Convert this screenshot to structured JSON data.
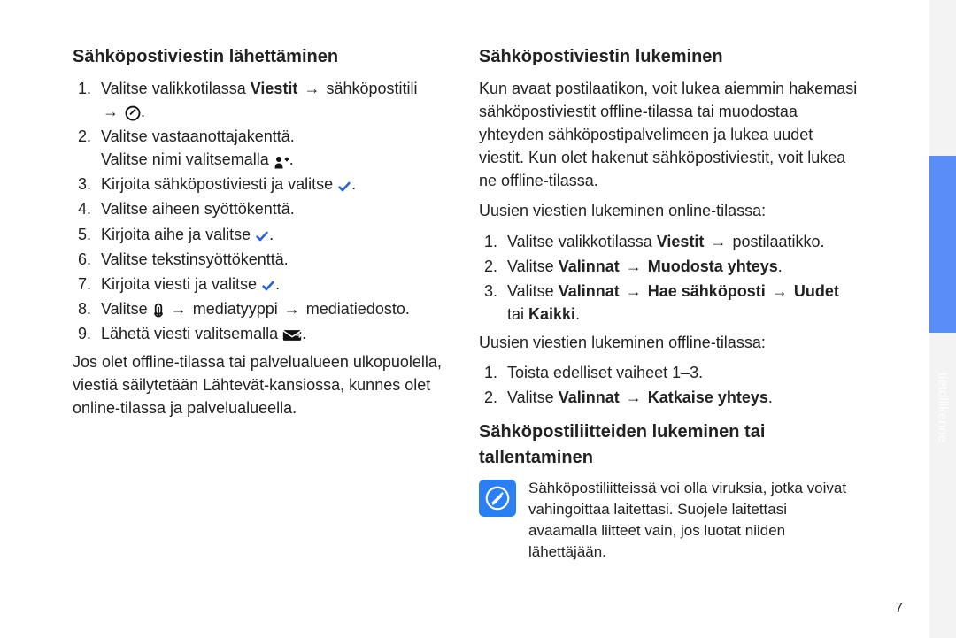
{
  "left": {
    "heading": "Sähköpostiviestin lähettäminen",
    "steps": {
      "s1a": "Valitse valikkotilassa ",
      "s1b": "Viestit",
      "s1c": " sähköpostitili ",
      "s2a": "Valitse vastaanottajakenttä.",
      "s2b": "Valitse nimi valitsemalla ",
      "s3": "Kirjoita sähköpostiviesti ja valitse ",
      "s4": "Valitse aiheen syöttökenttä.",
      "s5": "Kirjoita aihe ja valitse ",
      "s6": "Valitse tekstinsyöttökenttä.",
      "s7": "Kirjoita viesti ja valitse ",
      "s8a": "Valitse ",
      "s8b": " mediatyyppi ",
      "s8c": " mediatiedosto.",
      "s9": "Lähetä viesti valitsemalla "
    },
    "footer": "Jos olet offline-tilassa tai palvelualueen ulkopuolella, viestiä säilytetään Lähtevät-kansiossa, kunnes olet online-tilassa ja palvelualueella."
  },
  "right": {
    "heading1": "Sähköpostiviestin lukeminen",
    "intro": "Kun avaat postilaatikon, voit lukea aiemmin hakemasi sähköpostiviestit offline-tilassa tai muodostaa yhteyden sähköpostipalvelimeen ja lukea uudet viestit. Kun olet hakenut sähköpostiviestit, voit lukea ne offline-tilassa.",
    "online_lead": "Uusien viestien lukeminen online-tilassa:",
    "online": {
      "s1a": "Valitse valikkotilassa ",
      "s1b": "Viestit",
      "s1c": " postilaatikko.",
      "s2a": "Valitse ",
      "s2b": "Valinnat",
      "s2c": "Muodosta yhteys",
      "s3a": "Valitse ",
      "s3b": "Valinnat",
      "s3c": "Hae sähköposti",
      "s3d": "Uudet",
      "s3e": " tai ",
      "s3f": "Kaikki"
    },
    "offline_lead": "Uusien viestien lukeminen offline-tilassa:",
    "offline": {
      "s1": "Toista edelliset vaiheet 1–3.",
      "s2a": "Valitse ",
      "s2b": "Valinnat",
      "s2c": "Katkaise yhteys"
    },
    "heading2": "Sähköpostiliitteiden lukeminen tai tallentaminen",
    "note": "Sähköpostiliitteissä voi olla viruksia, jotka voivat vahingoittaa laitettasi. Suojele laitettasi avaamalla liitteet vain, jos luotat niiden lähettäjään."
  },
  "side_label": "tietoliikenne",
  "page_number": "7",
  "arrow": "→"
}
